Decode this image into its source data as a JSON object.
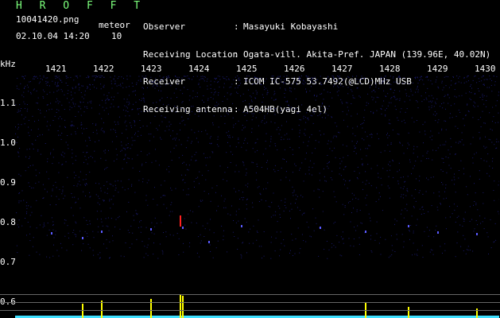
{
  "header": {
    "brand": "H R O F F T",
    "filename": "10041420.png",
    "meteor_label": "meteor",
    "datetime": "02.10.04 14:20",
    "meteor_count": "10"
  },
  "info": [
    {
      "label": "Observer",
      "value": "Masayuki Kobayashi"
    },
    {
      "label": "Receiving Location",
      "value": "Ogata-vill. Akita-Pref. JAPAN (139.96E, 40.02N)"
    },
    {
      "label": "Receiver",
      "value": "ICOM IC-575 53.7492(@LCD)MHz USB"
    },
    {
      "label": "Receiving antenna",
      "value": "A504HB(yagi 4el)"
    }
  ],
  "axis": {
    "y_unit": "kHz",
    "x_ticks": [
      "1421",
      "1422",
      "1423",
      "1424",
      "1425",
      "1426",
      "1427",
      "1428",
      "1429",
      "1430"
    ],
    "y_ticks": [
      "1.1",
      "1.0",
      "0.9",
      "0.8",
      "0.7",
      "0.6"
    ]
  },
  "colors": {
    "background": "#000000",
    "noise": "#1a1a6e",
    "signal": "#ff2020",
    "trace": "#ffff00",
    "baseline": "#40e0ff"
  }
}
